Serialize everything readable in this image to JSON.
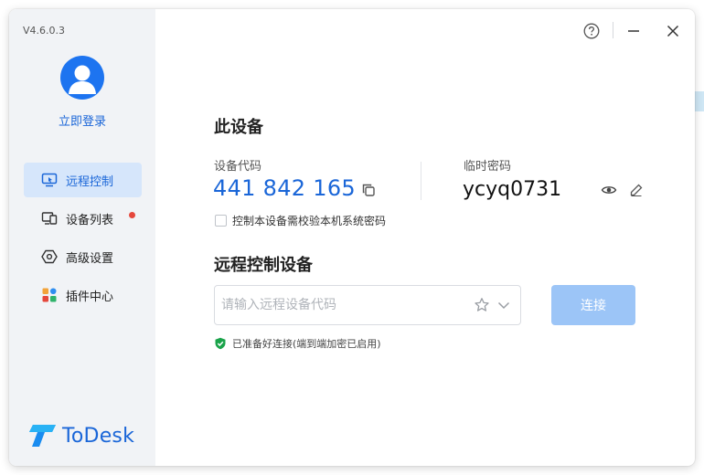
{
  "window": {
    "version": "V4.6.0.3"
  },
  "sidebar": {
    "login_label": "立即登录",
    "items": [
      {
        "label": "远程控制",
        "icon": "monitor-remote-icon",
        "active": true
      },
      {
        "label": "设备列表",
        "icon": "devices-icon",
        "badge": true
      },
      {
        "label": "高级设置",
        "icon": "settings-hexagon-icon"
      },
      {
        "label": "插件中心",
        "icon": "plugins-icon"
      }
    ],
    "brand": "ToDesk"
  },
  "device": {
    "title": "此设备",
    "code_label": "设备代码",
    "code": "441 842 165",
    "temp_pwd_label": "临时密码",
    "temp_pwd": "ycyq0731",
    "checkbox_label": "控制本设备需校验本机系统密码"
  },
  "remote": {
    "title": "远程控制设备",
    "placeholder": "请输入远程设备代码",
    "connect_label": "连接",
    "status": "已准备好连接(端到端加密已启用)"
  },
  "colors": {
    "accent": "#1a66d8",
    "connect_disabled": "#9cc5f7",
    "status_ok": "#1aa34a",
    "badge": "#e5473c"
  }
}
